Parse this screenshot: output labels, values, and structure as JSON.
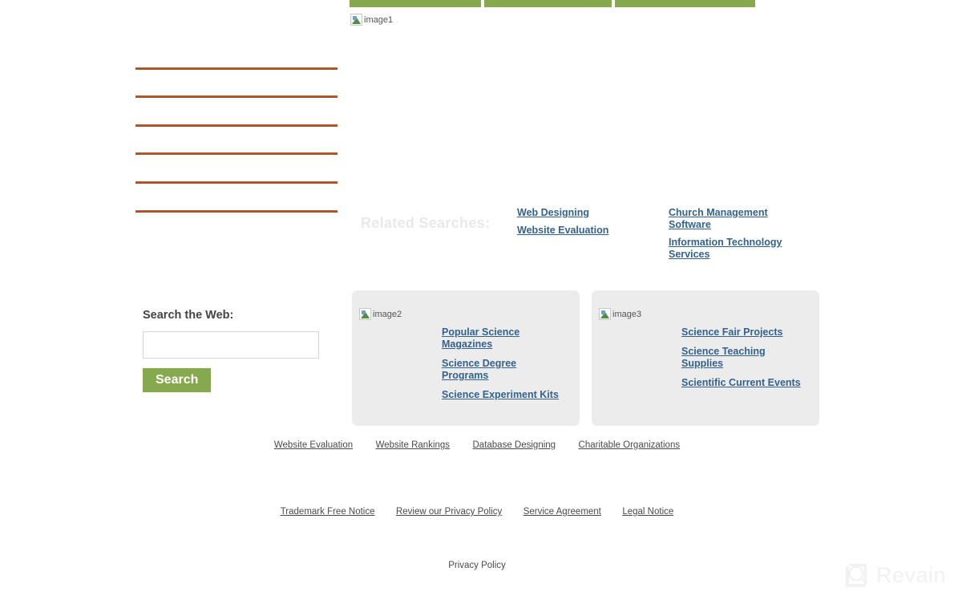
{
  "theme": {
    "green": "#86a94e",
    "rule_orange": "#a8522a",
    "link_blue": "#33628f",
    "box_gray": "#ececec",
    "label_faded": "#e9e9e9",
    "footer_gray": "#4a4a4a",
    "watermark_gray": "#f1f1f1"
  },
  "top_bars": [
    {
      "name": "green-bar-1"
    },
    {
      "name": "green-bar-2"
    },
    {
      "name": "green-bar-3"
    }
  ],
  "images": {
    "image1_alt": "image1",
    "image2_alt": "image2",
    "image3_alt": "image3"
  },
  "rules": [
    {
      "name": "divider-1"
    },
    {
      "name": "divider-2"
    },
    {
      "name": "divider-3"
    },
    {
      "name": "divider-4"
    },
    {
      "name": "divider-5"
    },
    {
      "name": "divider-6"
    }
  ],
  "related_searches": {
    "label": "Related Searches:",
    "column_1": [
      "Web Designing",
      "Website Evaluation"
    ],
    "column_2": [
      "Church Management Software",
      "Information Technology Services"
    ]
  },
  "search": {
    "label": "Search the Web:",
    "value": "",
    "placeholder": "",
    "button_label": "Search"
  },
  "content_boxes": [
    {
      "image_alt": "image2",
      "links": [
        "Popular Science Magazines",
        "Science Degree Programs",
        "Science Experiment Kits"
      ]
    },
    {
      "image_alt": "image3",
      "links": [
        "Science Fair Projects",
        "Science Teaching Supplies",
        "Scientific Current Events"
      ]
    }
  ],
  "footer": {
    "row_1": [
      "Website Evaluation",
      "Website Rankings",
      "Database Designing",
      "Charitable Organizations"
    ],
    "row_2": [
      "Trademark Free Notice",
      "Review our Privacy Policy",
      "Service Agreement",
      "Legal Notice"
    ],
    "row_3": "Privacy Policy"
  },
  "watermark": {
    "text": "Revain",
    "icon": "revain-logo-icon"
  }
}
